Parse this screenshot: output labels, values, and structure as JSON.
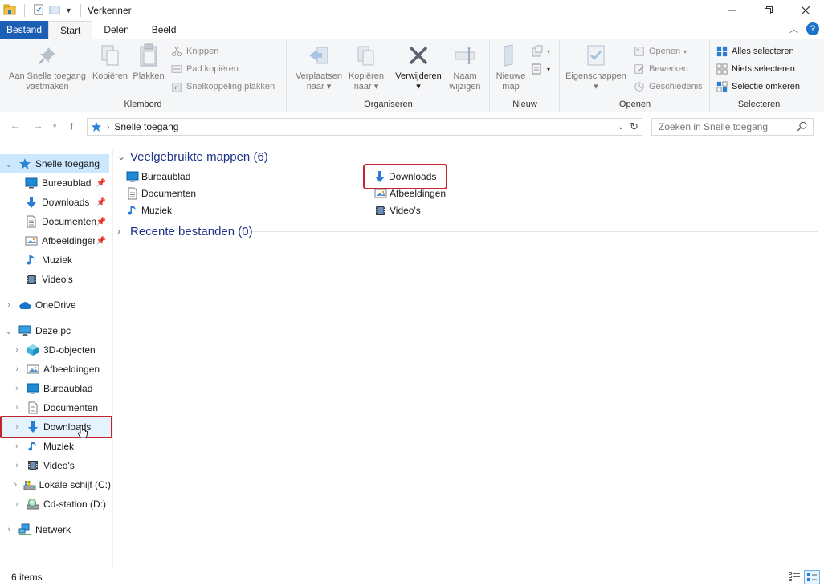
{
  "window": {
    "title": "Verkenner",
    "controls": [
      "minimize",
      "maximize",
      "close"
    ]
  },
  "ribbon_tabs": [
    {
      "label": "Bestand"
    },
    {
      "label": "Start"
    },
    {
      "label": "Delen"
    },
    {
      "label": "Beeld"
    }
  ],
  "ribbon": {
    "klembord": {
      "label": "Klembord",
      "pin_line1": "Aan Snelle toegang",
      "pin_line2": "vastmaken",
      "copy": "Kopiëren",
      "paste": "Plakken",
      "cut": "Knippen",
      "copy_path": "Pad kopiëren",
      "paste_shortcut": "Snelkoppeling plakken"
    },
    "organiseren": {
      "label": "Organiseren",
      "move_line1": "Verplaatsen",
      "move_line2": "naar",
      "copyto_line1": "Kopiëren",
      "copyto_line2": "naar",
      "delete": "Verwijderen",
      "rename_line1": "Naam",
      "rename_line2": "wijzigen"
    },
    "nieuw": {
      "label": "Nieuw",
      "newfolder_line1": "Nieuwe",
      "newfolder_line2": "map"
    },
    "openen": {
      "label": "Openen",
      "properties": "Eigenschappen",
      "open": "Openen",
      "edit": "Bewerken",
      "history": "Geschiedenis"
    },
    "selecteren": {
      "label": "Selecteren",
      "select_all": "Alles selecteren",
      "select_none": "Niets selecteren",
      "invert": "Selectie omkeren"
    }
  },
  "address": {
    "path": "Snelle toegang",
    "search_placeholder": "Zoeken in Snelle toegang"
  },
  "nav": {
    "quick_access": "Snelle toegang",
    "qa_items": [
      {
        "label": "Bureaublad",
        "icon": "desktop-icon"
      },
      {
        "label": "Downloads",
        "icon": "download-icon"
      },
      {
        "label": "Documenten",
        "icon": "document-icon"
      },
      {
        "label": "Afbeeldingen",
        "icon": "picture-icon"
      },
      {
        "label": "Muziek",
        "icon": "music-icon"
      },
      {
        "label": "Video's",
        "icon": "video-icon"
      }
    ],
    "onedrive": "OneDrive",
    "this_pc": "Deze pc",
    "pc_items": [
      {
        "label": "3D-objecten",
        "icon": "cube-icon"
      },
      {
        "label": "Afbeeldingen",
        "icon": "picture-icon"
      },
      {
        "label": "Bureaublad",
        "icon": "desktop-icon"
      },
      {
        "label": "Documenten",
        "icon": "document-icon"
      },
      {
        "label": "Downloads",
        "icon": "download-icon"
      },
      {
        "label": "Muziek",
        "icon": "music-icon"
      },
      {
        "label": "Video's",
        "icon": "video-icon"
      },
      {
        "label": "Lokale schijf (C:)",
        "icon": "drive-icon"
      },
      {
        "label": "Cd-station (D:)",
        "icon": "cd-drive-icon"
      }
    ],
    "network": "Netwerk"
  },
  "content": {
    "frequent_header": "Veelgebruikte mappen (6)",
    "frequent_folders": [
      {
        "label": "Bureaublad",
        "icon": "desktop-icon"
      },
      {
        "label": "Documenten",
        "icon": "document-icon"
      },
      {
        "label": "Muziek",
        "icon": "music-icon"
      },
      {
        "label": "Downloads",
        "icon": "download-icon"
      },
      {
        "label": "Afbeeldingen",
        "icon": "picture-icon"
      },
      {
        "label": "Video's",
        "icon": "video-icon"
      }
    ],
    "recent_header": "Recente bestanden (0)"
  },
  "status": {
    "item_count": "6 items"
  },
  "colors": {
    "accent": "#1a5fb4",
    "highlight_outline": "#c8232c",
    "selection": "#cce8ff",
    "group_header": "#1e3287"
  }
}
